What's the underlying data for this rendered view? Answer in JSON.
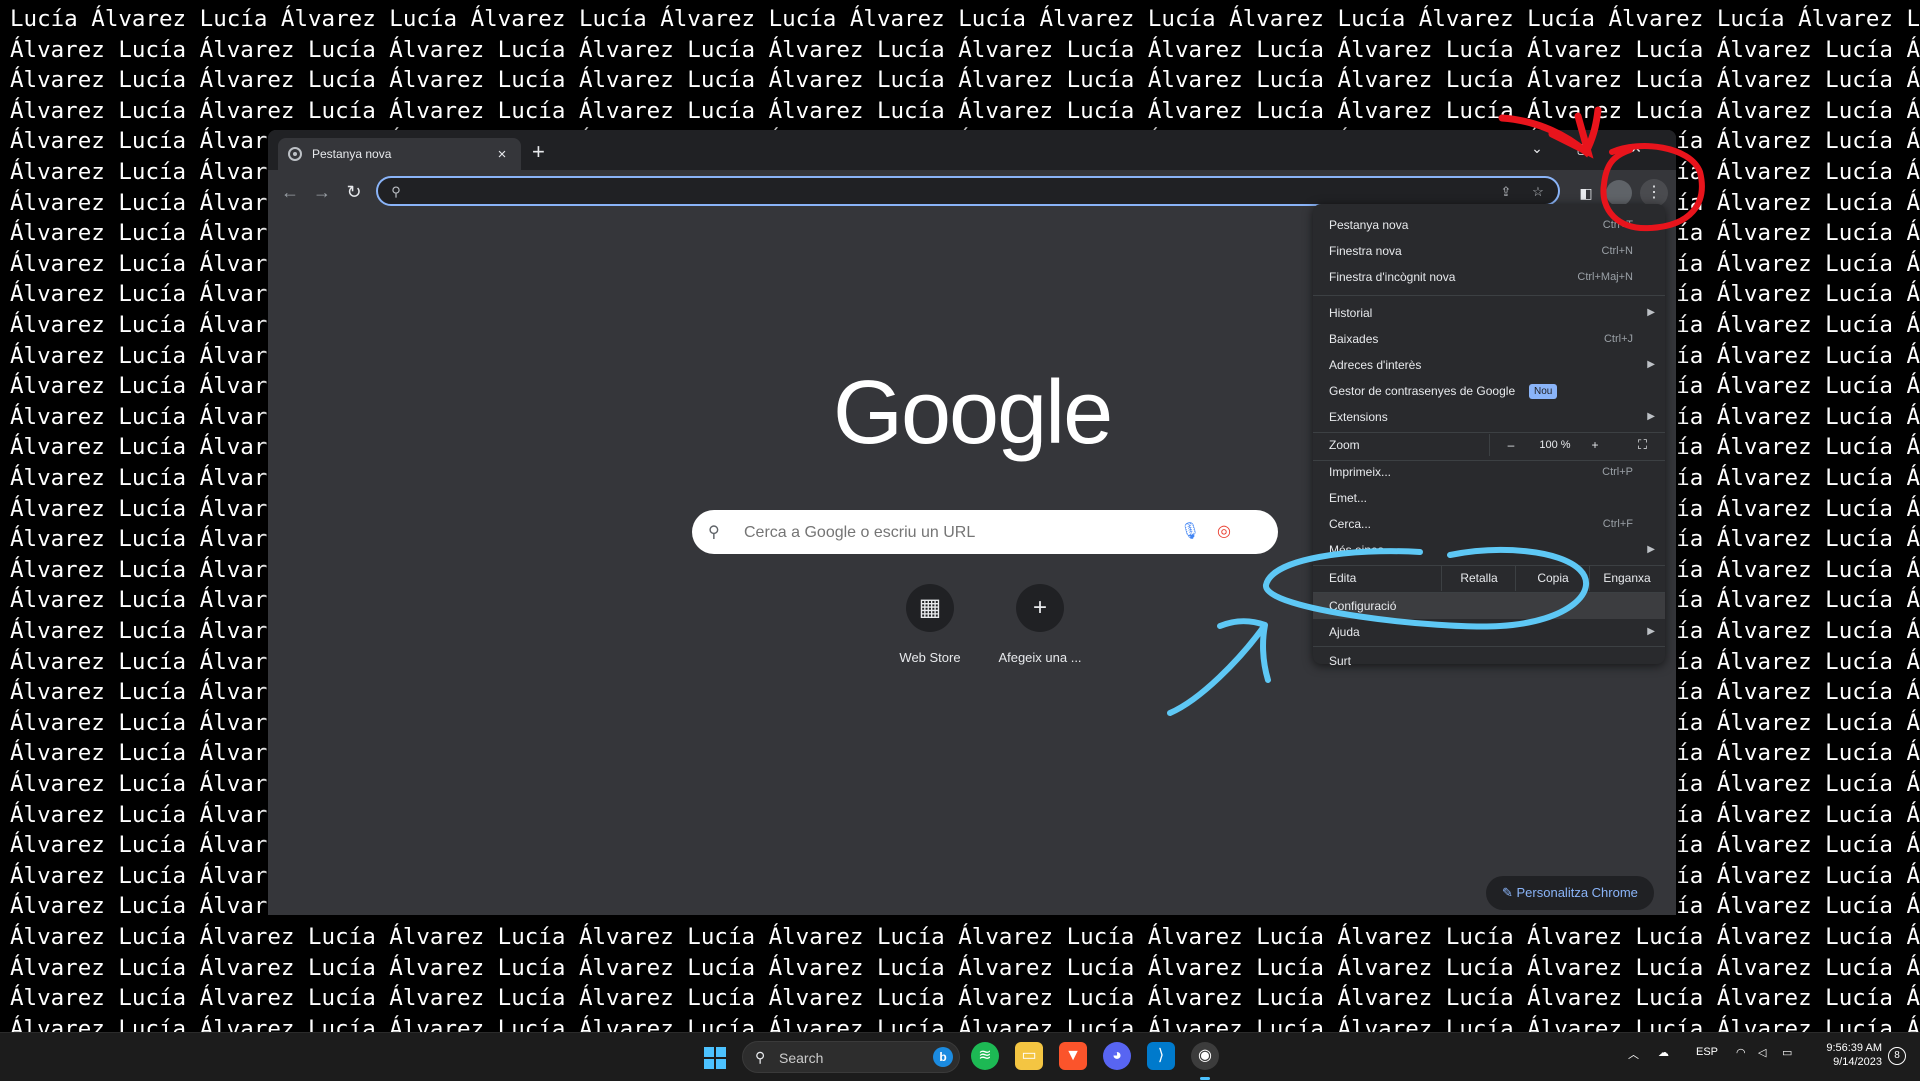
{
  "wallpaper": {
    "row_a": "Lucía Álvarez Lucía Álvarez Lucía Álvarez Lucía Álvarez Lucía Álvarez Lucía Álvarez Lucía Álvarez Lucía Álvarez Lucía Álvarez Lucía Álvarez Lucía Álvarez",
    "row_b": "Álvarez Lucía Álvarez Lucía Álvarez Lucía Álvarez Lucía Álvarez Lucía Álvarez Lucía Álvarez Lucía Álvarez Lucía Álvarez Lucía Álvarez Lucía Álvarez Lucía Álvarez"
  },
  "browser": {
    "tab_title": "Pestanya nova",
    "tab_close": "×",
    "new_tab": "+",
    "window_controls": [
      "⌄",
      "▢",
      "✕"
    ],
    "omnibox_value": "",
    "logo": "Google",
    "search_placeholder": "Cerca a Google o escriu un URL",
    "shortcuts": [
      {
        "label": "Web Store",
        "icon": "web-store-icon"
      },
      {
        "label": "Afegeix una ...",
        "icon": "plus-icon"
      }
    ],
    "customize_label": "Personalitza Chrome"
  },
  "menu": {
    "items": [
      {
        "label": "Pestanya nova",
        "shortcut": "Ctrl+T"
      },
      {
        "label": "Finestra nova",
        "shortcut": "Ctrl+N"
      },
      {
        "label": "Finestra d'incògnit nova",
        "shortcut": "Ctrl+Maj+N"
      },
      {
        "label": "Historial",
        "shortcut": ""
      },
      {
        "label": "Baixades",
        "shortcut": "Ctrl+J"
      },
      {
        "label": "Adreces d'interès",
        "shortcut": ""
      },
      {
        "label": "Gestor de contrasenyes de Google",
        "shortcut": "",
        "badge": "Nou"
      },
      {
        "label": "Extensions",
        "shortcut": ""
      },
      {
        "label": "Zoom",
        "zoom_minus": "–",
        "zoom_value": "100 %",
        "zoom_plus": "+"
      },
      {
        "label": "Imprimeix...",
        "shortcut": "Ctrl+P"
      },
      {
        "label": "Emet...",
        "shortcut": ""
      },
      {
        "label": "Cerca...",
        "shortcut": "Ctrl+F"
      },
      {
        "label": "Més eines",
        "shortcut": ""
      },
      {
        "label": "Edita",
        "cut": "Retalla",
        "copy": "Copia",
        "paste": "Enganxa"
      },
      {
        "label": "Configuració",
        "shortcut": ""
      },
      {
        "label": "Ajuda",
        "shortcut": ""
      },
      {
        "label": "Surt",
        "shortcut": ""
      }
    ]
  },
  "taskbar": {
    "search_label": "Search",
    "lang": "ESP",
    "time": "9:56:39 AM",
    "date": "9/14/2023"
  },
  "colors": {
    "omnibox_focus": "#8ab4f8",
    "annotation_red": "#e8141c",
    "annotation_blue": "#5ec8f5"
  }
}
